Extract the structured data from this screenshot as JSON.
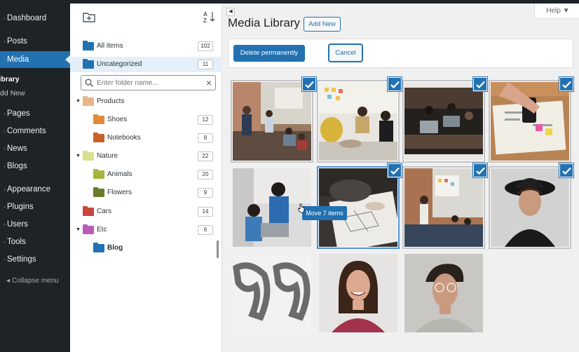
{
  "admin_menu": {
    "items": [
      {
        "label": "Dashboard",
        "active": false
      },
      {
        "label": "Posts",
        "active": false
      },
      {
        "label": "Media",
        "active": true
      },
      {
        "label": "Pages",
        "active": false
      },
      {
        "label": "Comments",
        "active": false
      },
      {
        "label": "News",
        "active": false
      },
      {
        "label": "Blogs",
        "active": false
      },
      {
        "label": "Appearance",
        "active": false
      },
      {
        "label": "Plugins",
        "active": false
      },
      {
        "label": "Users",
        "active": false
      },
      {
        "label": "Tools",
        "active": false
      },
      {
        "label": "Settings",
        "active": false
      }
    ],
    "submenu": [
      {
        "label": "Library",
        "current": true
      },
      {
        "label": "Add New",
        "current": false
      }
    ],
    "collapse_label": "Collapse menu"
  },
  "folders": {
    "search_placeholder": "Enter folder name...",
    "items": [
      {
        "label": "All items",
        "count": "102",
        "color": "#2271b1",
        "selected": false
      },
      {
        "label": "Uncategorized",
        "count": "11",
        "color": "#2271b1",
        "selected": true
      },
      {
        "label": "Products",
        "count": "",
        "color": "#e8b48a",
        "selected": false
      },
      {
        "label": "Shoes",
        "count": "12",
        "color": "#e08c3c",
        "selected": false
      },
      {
        "label": "Notebooks",
        "count": "8",
        "color": "#c8602a",
        "selected": false
      },
      {
        "label": "Nature",
        "count": "22",
        "color": "#d8e08c",
        "selected": false
      },
      {
        "label": "Animals",
        "count": "20",
        "color": "#a8b43c",
        "selected": false
      },
      {
        "label": "Flowers",
        "count": "9",
        "color": "#6b7a2a",
        "selected": false
      },
      {
        "label": "Cars",
        "count": "14",
        "color": "#c8463c",
        "selected": false
      },
      {
        "label": "Etc",
        "count": "6",
        "color": "#b85cb8",
        "selected": false
      },
      {
        "label": "Blog",
        "count": "",
        "color": "#2271b1",
        "selected": false
      }
    ]
  },
  "main": {
    "help_label": "Help ▼",
    "title": "Media Library",
    "add_new_label": "Add New",
    "delete_label": "Delete permanently",
    "cancel_label": "Cancel",
    "drag_tooltip": "Move 7 items"
  },
  "colors": {
    "accent": "#2271b1",
    "admin_bg": "#1d2327"
  },
  "media_tiles": [
    {
      "name": "office-meeting-photo",
      "selected": true
    },
    {
      "name": "team-brainstorm-photo",
      "selected": true
    },
    {
      "name": "laptop-workspace-photo",
      "selected": true
    },
    {
      "name": "desk-phone-photo",
      "selected": true
    },
    {
      "name": "women-at-laptop-photo",
      "selected": false
    },
    {
      "name": "blueprint-drawing-photo",
      "selected": true
    },
    {
      "name": "presentation-room-photo",
      "selected": true
    },
    {
      "name": "man-with-hat-photo",
      "selected": true
    },
    {
      "name": "quote-marks-image",
      "selected": false
    },
    {
      "name": "smiling-woman-photo",
      "selected": false
    },
    {
      "name": "man-with-glasses-photo",
      "selected": false
    }
  ]
}
